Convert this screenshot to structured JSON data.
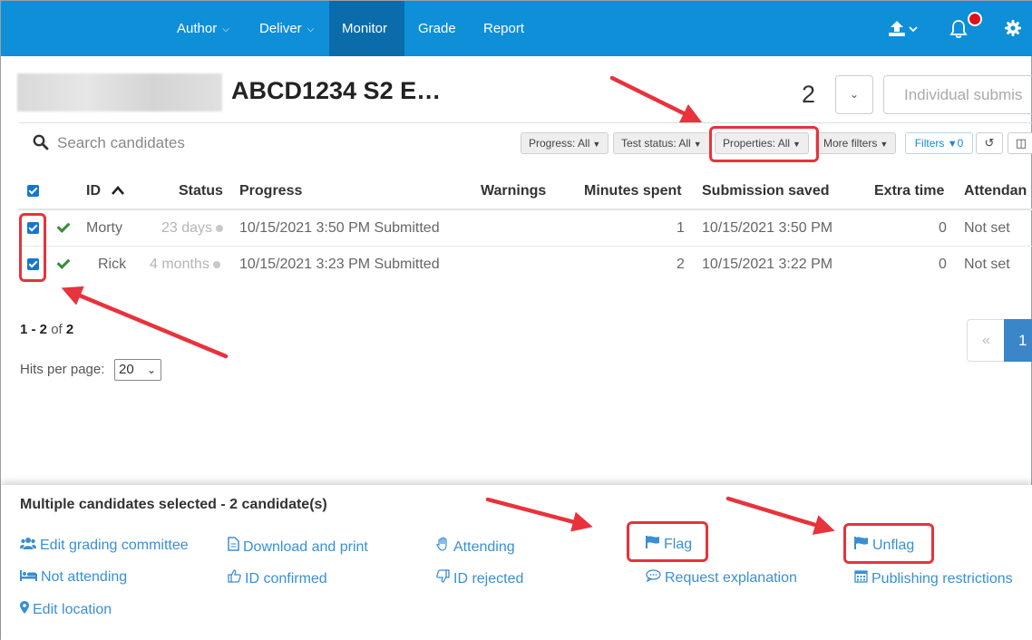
{
  "nav": {
    "items": [
      {
        "label": "Author",
        "has_caret": true
      },
      {
        "label": "Deliver",
        "has_caret": true
      },
      {
        "label": "Monitor",
        "active": true
      },
      {
        "label": "Grade"
      },
      {
        "label": "Report"
      }
    ],
    "icons": [
      "upload-icon",
      "bell-icon",
      "gear-icon"
    ],
    "bar_color": "#0e8fd8",
    "active_color": "#0a6cab"
  },
  "header": {
    "title": "ABCD1234 S2 E…",
    "count": "2",
    "individual_button": "Individual submis"
  },
  "search": {
    "placeholder": "Search candidates"
  },
  "filters": {
    "progress": "Progress: All",
    "test_status": "Test status: All",
    "properties": "Properties: All",
    "more": "More filters",
    "filters_label": "Filters",
    "filters_count": "0"
  },
  "table": {
    "headers": {
      "id": "ID",
      "status": "Status",
      "progress": "Progress",
      "warnings": "Warnings",
      "minutes": "Minutes spent",
      "saved": "Submission saved",
      "extra": "Extra time",
      "attendance": "Attendan"
    },
    "rows": [
      {
        "id": "Morty",
        "status": "23 days",
        "progress": "10/15/2021 3:50 PM Submitted",
        "warnings": "",
        "minutes": "1",
        "saved": "10/15/2021 3:50 PM",
        "extra": "0",
        "attendance": "Not set"
      },
      {
        "id": "Rick",
        "status": "4 months",
        "progress": "10/15/2021 3:23 PM Submitted",
        "warnings": "",
        "minutes": "2",
        "saved": "10/15/2021 3:22 PM",
        "extra": "0",
        "attendance": "Not set"
      }
    ]
  },
  "pagination": {
    "range": "1 - 2",
    "of": "of",
    "total": "2",
    "hits_label": "Hits per page:",
    "hits_value": "20",
    "prev": "«",
    "current": "1"
  },
  "bulk": {
    "title": "Multiple candidates selected - 2 candidate(s)",
    "actions": {
      "edit_grading_committee": "Edit grading committee",
      "download_print": "Download and print",
      "attending": "Attending",
      "flag": "Flag",
      "unflag": "Unflag",
      "not_attending": "Not attending",
      "id_confirmed": "ID confirmed",
      "id_rejected": "ID rejected",
      "request_explanation": "Request explanation",
      "publishing_restrictions": "Publishing restrictions",
      "edit_location": "Edit location"
    }
  },
  "colors": {
    "link": "#3a8fd3",
    "annotation": "#e8323c",
    "checkbox": "#1576d2"
  }
}
